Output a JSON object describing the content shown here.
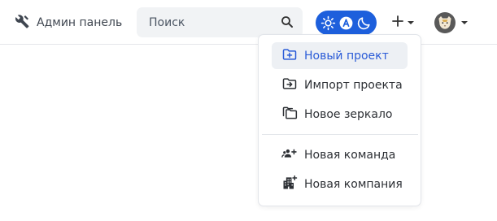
{
  "header": {
    "admin_label": "Админ панель",
    "search_placeholder": "Поиск",
    "accent_color": "#1d5fdc"
  },
  "theme_switch": {
    "options": [
      "sun-icon",
      "auto-icon",
      "moon-icon"
    ],
    "selected": "auto-icon"
  },
  "create_menu": {
    "items": [
      {
        "label": "Новый проект",
        "icon": "folder-plus-icon",
        "active": true
      },
      {
        "label": "Импорт проекта",
        "icon": "folder-import-icon",
        "active": false
      },
      {
        "label": "Новое зеркало",
        "icon": "mirror-icon",
        "active": false
      },
      {
        "label": "Новая команда",
        "icon": "team-plus-icon",
        "active": false
      },
      {
        "label": "Новая компания",
        "icon": "company-plus-icon",
        "active": false
      }
    ]
  }
}
